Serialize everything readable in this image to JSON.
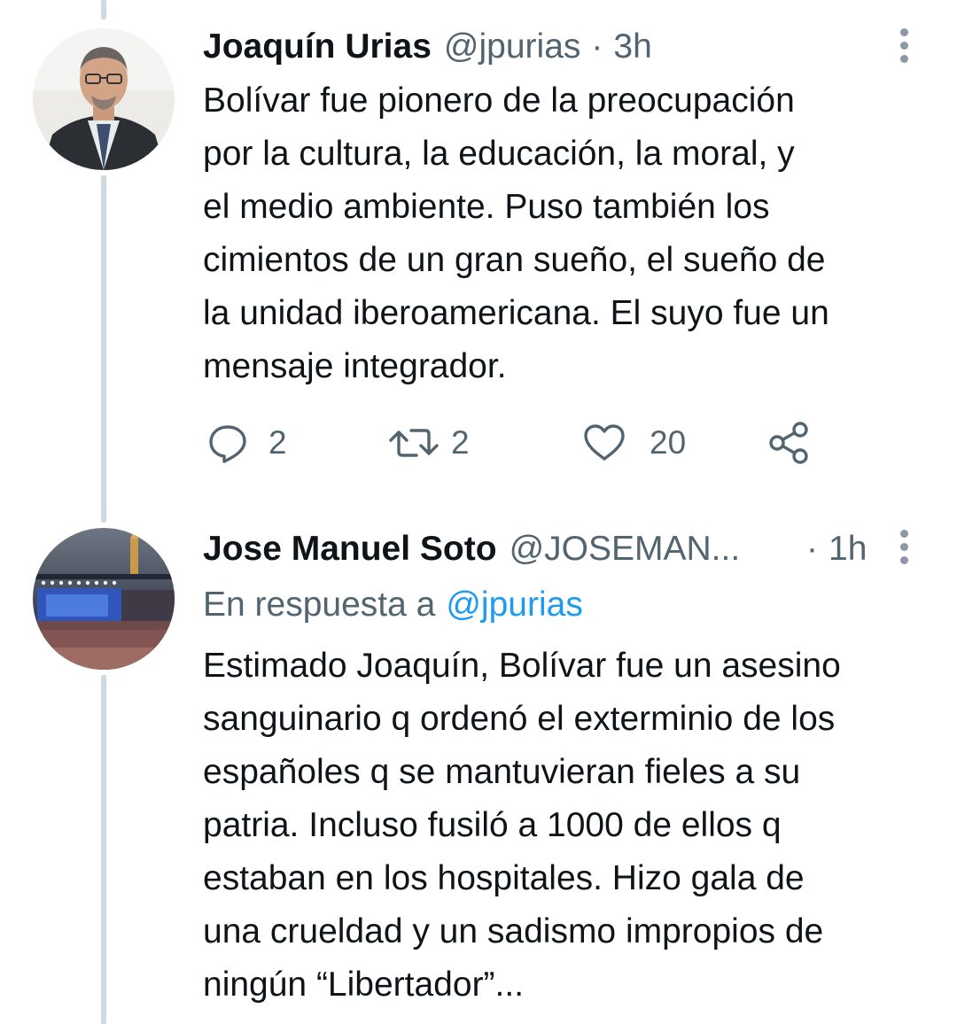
{
  "tweets": [
    {
      "name": "Joaquín Urias",
      "handle": "@jpurias",
      "separator": "·",
      "time": "3h",
      "text": "Bolívar fue pionero de la preocupación\npor la cultura, la educación, la moral, y\nel medio ambiente. Puso también los\ncimientos de un gran sueño, el sueño de\nla unidad iberoamericana. El suyo fue un\nmensaje integrador.",
      "actions": {
        "reply_icon": "reply-icon",
        "reply_count": "2",
        "retweet_icon": "retweet-icon",
        "retweet_count": "2",
        "like_icon": "heart-icon",
        "like_count": "20",
        "share_icon": "share-icon"
      }
    },
    {
      "name": "Jose Manuel Soto",
      "handle": "@JOSEMAN...",
      "separator": "·",
      "time": "1h",
      "reply_prefix": "En respuesta a",
      "reply_to": "@jpurias",
      "text": "Estimado Joaquín, Bolívar fue un asesino\nsanguinario q ordenó el exterminio de los\nespañoles q se mantuvieran fieles a su\npatria. Incluso fusiló a 1000 de ellos q\nestaban en los hospitales. Hizo gala de\nuna crueldad y un sadismo impropios de\nningún “Libertador”..."
    }
  ],
  "colors": {
    "text_primary": "#0f1419",
    "text_secondary": "#536471",
    "link": "#1d9bf0",
    "thread_line": "#cfd9de"
  }
}
